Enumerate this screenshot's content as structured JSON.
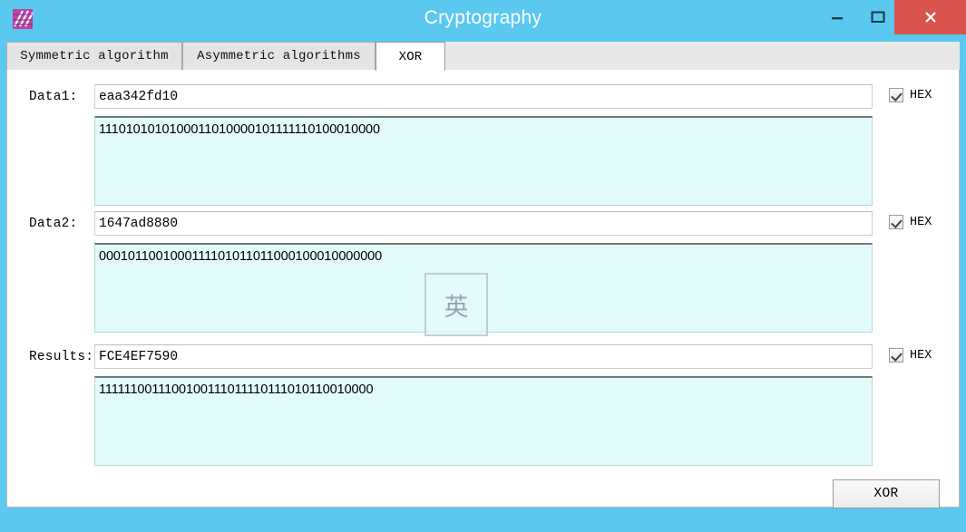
{
  "window": {
    "title": "Cryptography",
    "icon": "app-icon",
    "controls": {
      "minimize": "minimize-icon",
      "maximize": "maximize-icon",
      "close": "close-icon"
    },
    "accent_color": "#5ac8ef",
    "close_color": "#d9534f"
  },
  "tabs": [
    {
      "label": "Symmetric algorithm",
      "active": false
    },
    {
      "label": "Asymmetric algorithms",
      "active": false
    },
    {
      "label": "XOR",
      "active": true
    }
  ],
  "fields": [
    {
      "label": "Data1:",
      "hex_value": "eaa342fd10",
      "binary_value": "1110101010100011010000101111110100010000",
      "hex_checkbox": {
        "label": "HEX",
        "checked": true
      }
    },
    {
      "label": "Data2:",
      "hex_value": "1647ad8880",
      "binary_value": "0001011001000111101011011000100010000000",
      "hex_checkbox": {
        "label": "HEX",
        "checked": true
      }
    },
    {
      "label": "Results:",
      "hex_value": "FCE4EF7590",
      "binary_value": "1111110011100100111011110111010110010000",
      "hex_checkbox": {
        "label": "HEX",
        "checked": true
      }
    }
  ],
  "ime": {
    "mode_glyph": "英"
  },
  "actions": {
    "xor_button": "XOR"
  }
}
